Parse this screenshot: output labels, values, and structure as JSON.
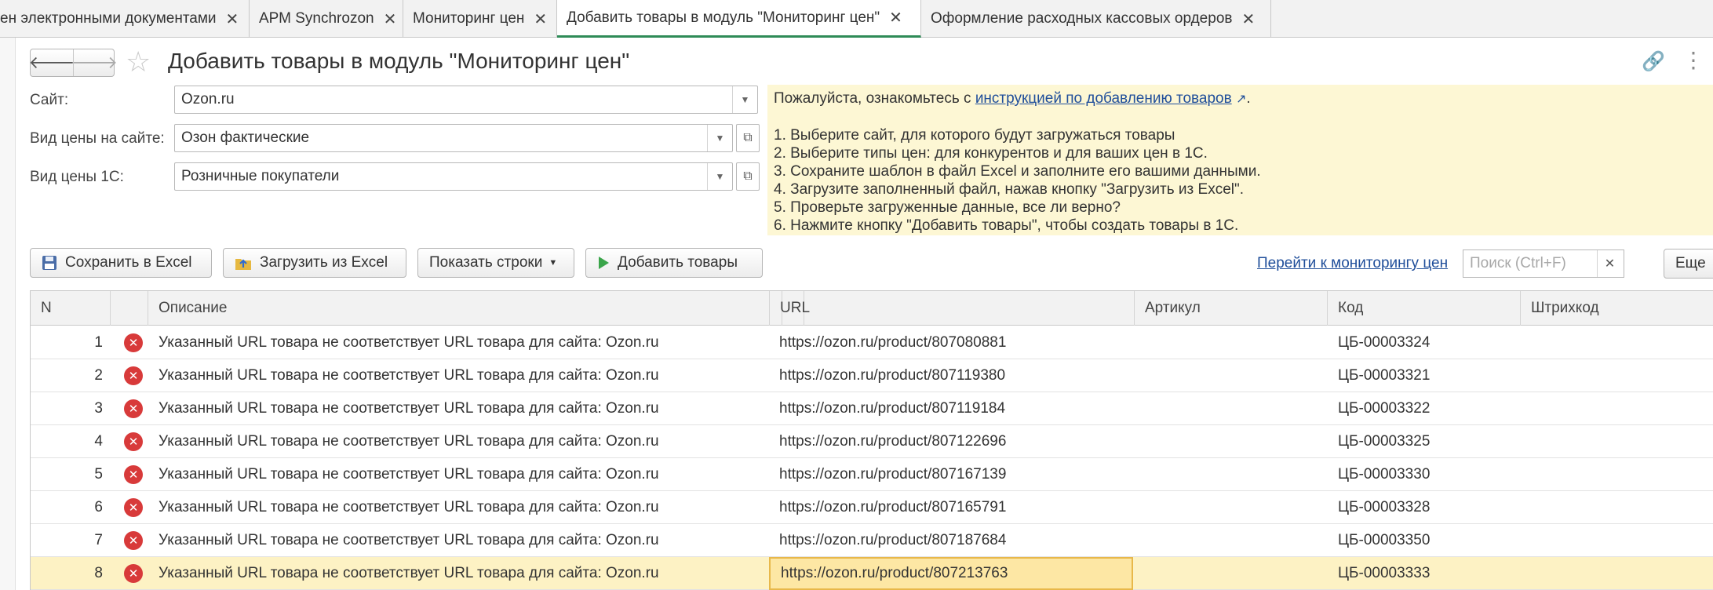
{
  "tabs": [
    {
      "label": "ен электронными документами",
      "active": false
    },
    {
      "label": "АРМ Synchrozon",
      "active": false
    },
    {
      "label": "Мониторинг цен",
      "active": false
    },
    {
      "label": "Добавить товары в модуль \"Мониторинг цен\"",
      "active": true
    },
    {
      "label": "Оформление расходных кассовых ордеров",
      "active": false
    }
  ],
  "header": {
    "title": "Добавить товары в модуль \"Мониторинг цен\""
  },
  "form": {
    "site_label": "Сайт:",
    "site_value": "Ozon.ru",
    "site_price_label": "Вид цены на сайте:",
    "site_price_value": "Озон фактические",
    "price_1c_label": "Вид цены 1С:",
    "price_1c_value": "Розничные покупатели"
  },
  "info": {
    "intro": "Пожалуйста, ознакомьтесь с ",
    "link": "инструкцией по добавлению товаров",
    "intro_end": ".",
    "steps": [
      "1. Выберите сайт, для которого будут загружаться товары",
      "2. Выберите типы цен: для конкурентов и для ваших цен в 1С.",
      "3. Сохраните шаблон в файл Excel и заполните его вашими данными.",
      "4. Загрузите заполненный файл, нажав кнопку \"Загрузить из Excel\".",
      "5. Проверьте загруженные данные, все ли верно?",
      "6. Нажмите кнопку \"Добавить товары\", чтобы создать товары в 1С."
    ]
  },
  "toolbar": {
    "save_excel": "Сохранить в Excel",
    "load_excel": "Загрузить из Excel",
    "show_rows": "Показать строки",
    "add_items": "Добавить товары",
    "goto_monitoring": "Перейти к мониторингу цен",
    "search_placeholder": "Поиск (Ctrl+F)",
    "more": "Еще"
  },
  "table": {
    "columns": [
      "N",
      "Описание",
      "URL",
      "Артикул",
      "Код",
      "Штрихкод"
    ],
    "rows": [
      {
        "n": "1",
        "desc": "Указанный URL товара не соответствует URL товара для сайта: Ozon.ru",
        "url": "https://ozon.ru/product/807080881",
        "article": "",
        "code": "ЦБ-00003324",
        "barcode": ""
      },
      {
        "n": "2",
        "desc": "Указанный URL товара не соответствует URL товара для сайта: Ozon.ru",
        "url": "https://ozon.ru/product/807119380",
        "article": "",
        "code": "ЦБ-00003321",
        "barcode": ""
      },
      {
        "n": "3",
        "desc": "Указанный URL товара не соответствует URL товара для сайта: Ozon.ru",
        "url": "https://ozon.ru/product/807119184",
        "article": "",
        "code": "ЦБ-00003322",
        "barcode": ""
      },
      {
        "n": "4",
        "desc": "Указанный URL товара не соответствует URL товара для сайта: Ozon.ru",
        "url": "https://ozon.ru/product/807122696",
        "article": "",
        "code": "ЦБ-00003325",
        "barcode": ""
      },
      {
        "n": "5",
        "desc": "Указанный URL товара не соответствует URL товара для сайта: Ozon.ru",
        "url": "https://ozon.ru/product/807167139",
        "article": "",
        "code": "ЦБ-00003330",
        "barcode": ""
      },
      {
        "n": "6",
        "desc": "Указанный URL товара не соответствует URL товара для сайта: Ozon.ru",
        "url": "https://ozon.ru/product/807165791",
        "article": "",
        "code": "ЦБ-00003328",
        "barcode": ""
      },
      {
        "n": "7",
        "desc": "Указанный URL товара не соответствует URL товара для сайта: Ozon.ru",
        "url": "https://ozon.ru/product/807187684",
        "article": "",
        "code": "ЦБ-00003350",
        "barcode": ""
      },
      {
        "n": "8",
        "desc": "Указанный URL товара не соответствует URL товара для сайта: Ozon.ru",
        "url": "https://ozon.ru/product/807213763",
        "article": "",
        "code": "ЦБ-00003333",
        "barcode": ""
      }
    ],
    "selected_row": 7
  },
  "colors": {
    "accent": "#2e8b57",
    "error": "#d83a3a",
    "info_bg": "#fdf7d4",
    "link": "#1f4e9a"
  },
  "icons": {
    "back": "arrow-left-icon",
    "forward": "arrow-right-icon",
    "favorite": "star-icon",
    "link": "link-icon",
    "more": "more-vertical-icon",
    "row_status": "error-circle-icon"
  }
}
